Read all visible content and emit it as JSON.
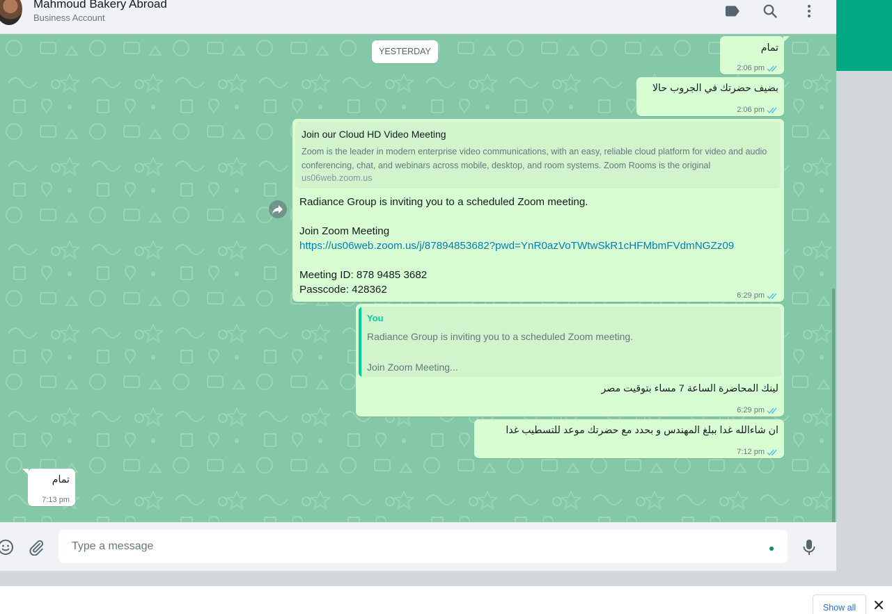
{
  "header": {
    "contact_name": "Mahmoud Bakery Abroad",
    "subtitle": "Business Account",
    "icons": [
      "label-icon",
      "search-icon",
      "menu-icon"
    ]
  },
  "chat": {
    "date_separator": "YESTERDAY",
    "messages": [
      {
        "direction": "outgoing",
        "text": "تمام",
        "time": "2:06 pm",
        "status": "read"
      },
      {
        "direction": "outgoing",
        "text": "بضيف حضرتك في الجروب حالا",
        "time": "2:06 pm",
        "status": "read"
      },
      {
        "direction": "outgoing",
        "forwarded": true,
        "preview": {
          "title": "Join our Cloud HD Video Meeting",
          "description": "Zoom is the leader in modern enterprise video communications, with an easy, reliable cloud platform for video and audio conferencing, chat, and webinars across mobile, desktop, and room systems. Zoom Rooms is the original",
          "domain": "us06web.zoom.us"
        },
        "line1": "Radiance Group is inviting you to a scheduled Zoom meeting.",
        "line2": "Join Zoom Meeting",
        "link": "https://us06web.zoom.us/j/87894853682?pwd=YnR0azVoTWtwSkR1cHFMbmFVdmNGZz09",
        "line3": "Meeting ID: 878 9485 3682",
        "line4": "Passcode: 428362",
        "time": "6:29 pm",
        "status": "read"
      },
      {
        "direction": "outgoing",
        "quote": {
          "author": "You",
          "line1": "Radiance Group is inviting you to a scheduled Zoom meeting.",
          "line2": "Join Zoom Meeting..."
        },
        "text": "لينك المحاضرة الساعة 7 مساء بتوقيت مصر",
        "time": "6:29 pm",
        "status": "read"
      },
      {
        "direction": "outgoing",
        "text": "ان شاءالله غدا ببلغ المهندس و بحدد مع حضرتك موعد للتسطيب غدا",
        "time": "7:12 pm",
        "status": "read"
      },
      {
        "direction": "incoming",
        "text": "تمام",
        "time": "7:13 pm"
      }
    ]
  },
  "composer": {
    "placeholder": "Type a message",
    "icons": [
      "emoji-icon",
      "attach-icon",
      "mic-icon"
    ]
  },
  "download_bar": {
    "show_all_label": "Show all"
  },
  "colors": {
    "chat_background": "#85c8a8",
    "outgoing_bubble": "#d9fdd3",
    "incoming_bubble": "#ffffff",
    "accent": "#00a884",
    "read_ticks": "#53bdeb",
    "link": "#027eb5"
  }
}
